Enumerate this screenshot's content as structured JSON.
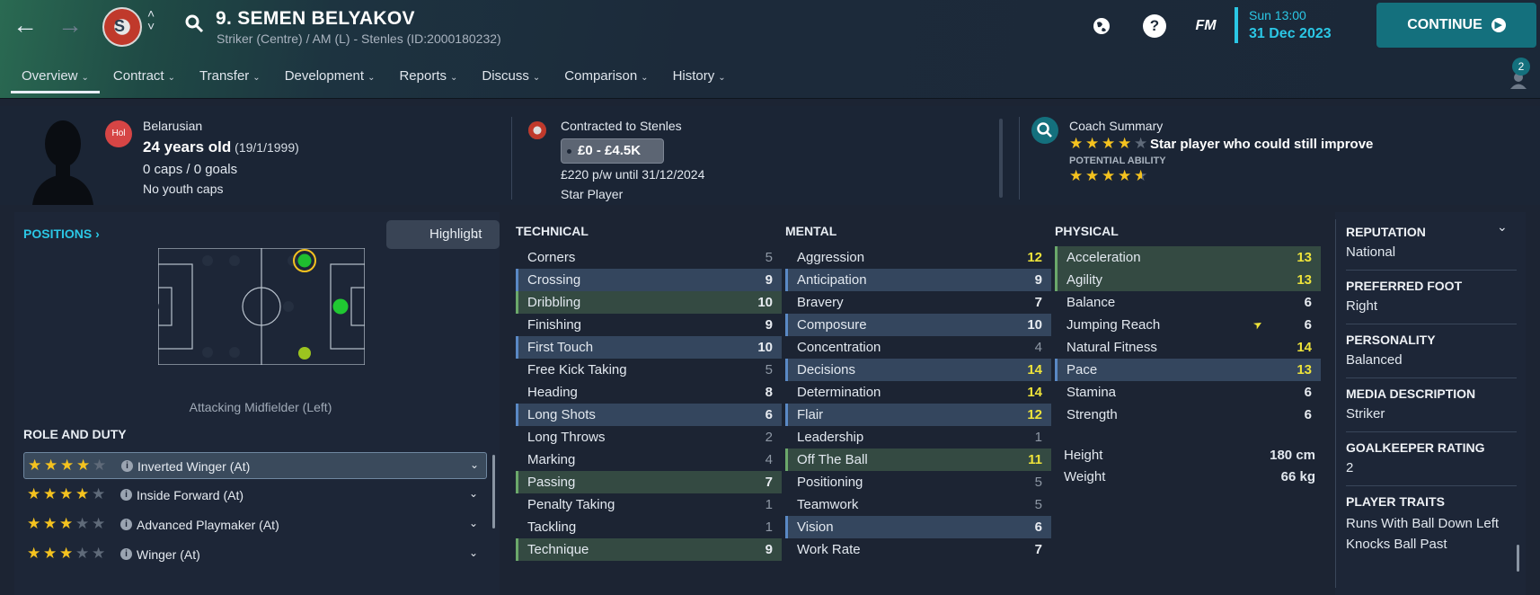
{
  "header": {
    "player_title": "9. SEMEN BELYAKOV",
    "subtitle": "Striker (Centre) / AM (L) - Stenles (ID:2000180232)",
    "fm_label": "FM",
    "time": "Sun 13:00",
    "date": "31 Dec 2023",
    "continue_label": "CONTINUE",
    "notification_count": "2",
    "icons": [
      "back-arrow-icon",
      "forward-arrow-icon",
      "club-badge-icon",
      "search-icon",
      "globe-icon",
      "help-icon",
      "notification-icon"
    ]
  },
  "tabs": [
    {
      "label": "Overview",
      "active": true
    },
    {
      "label": "Contract"
    },
    {
      "label": "Transfer"
    },
    {
      "label": "Development"
    },
    {
      "label": "Reports"
    },
    {
      "label": "Discuss"
    },
    {
      "label": "Comparison"
    },
    {
      "label": "History"
    }
  ],
  "profile": {
    "flag_label": "Hol",
    "nationality": "Belarusian",
    "age": "24 years old",
    "dob": "(19/1/1999)",
    "caps": "0 caps / 0 goals",
    "youth_caps": "No youth caps",
    "contracted": "Contracted to Stenles",
    "value": "£0 - £4.5K",
    "wage": "£220 p/w until 31/12/2024",
    "status": "Star Player",
    "coach_label": "Coach Summary",
    "coach_summary": "Star player who could still improve",
    "current_ability_stars": 4,
    "potential_label": "POTENTIAL ABILITY",
    "potential_ability_stars": 4.5
  },
  "positions": {
    "link_label": "POSITIONS",
    "highlight_label": "Highlight",
    "caption": "Attacking Midfielder (Left)",
    "role_header": "ROLE AND DUTY",
    "roles": [
      {
        "label": "Inverted Winger (At)",
        "stars": 4,
        "selected": true
      },
      {
        "label": "Inside Forward (At)",
        "stars": 4
      },
      {
        "label": "Advanced Playmaker (At)",
        "stars": 3
      },
      {
        "label": "Winger (At)",
        "stars": 3
      }
    ]
  },
  "technical": {
    "header": "TECHNICAL",
    "rows": [
      {
        "name": "Corners",
        "value": "5",
        "style": "plain",
        "tone": "low"
      },
      {
        "name": "Crossing",
        "value": "9",
        "style": "blue"
      },
      {
        "name": "Dribbling",
        "value": "10",
        "style": "green"
      },
      {
        "name": "Finishing",
        "value": "9",
        "style": "plain"
      },
      {
        "name": "First Touch",
        "value": "10",
        "style": "blue"
      },
      {
        "name": "Free Kick Taking",
        "value": "5",
        "style": "plain",
        "tone": "low"
      },
      {
        "name": "Heading",
        "value": "8",
        "style": "plain"
      },
      {
        "name": "Long Shots",
        "value": "6",
        "style": "blue"
      },
      {
        "name": "Long Throws",
        "value": "2",
        "style": "plain",
        "tone": "low"
      },
      {
        "name": "Marking",
        "value": "4",
        "style": "plain",
        "tone": "low"
      },
      {
        "name": "Passing",
        "value": "7",
        "style": "green"
      },
      {
        "name": "Penalty Taking",
        "value": "1",
        "style": "plain",
        "tone": "low"
      },
      {
        "name": "Tackling",
        "value": "1",
        "style": "plain",
        "tone": "low"
      },
      {
        "name": "Technique",
        "value": "9",
        "style": "green"
      }
    ]
  },
  "mental": {
    "header": "MENTAL",
    "rows": [
      {
        "name": "Aggression",
        "value": "12",
        "style": "plain",
        "tone": "yel"
      },
      {
        "name": "Anticipation",
        "value": "9",
        "style": "blue"
      },
      {
        "name": "Bravery",
        "value": "7",
        "style": "plain"
      },
      {
        "name": "Composure",
        "value": "10",
        "style": "blue"
      },
      {
        "name": "Concentration",
        "value": "4",
        "style": "plain",
        "tone": "low"
      },
      {
        "name": "Decisions",
        "value": "14",
        "style": "blue",
        "tone": "yel"
      },
      {
        "name": "Determination",
        "value": "14",
        "style": "plain",
        "tone": "yel"
      },
      {
        "name": "Flair",
        "value": "12",
        "style": "blue",
        "tone": "yel"
      },
      {
        "name": "Leadership",
        "value": "1",
        "style": "plain",
        "tone": "low"
      },
      {
        "name": "Off The Ball",
        "value": "11",
        "style": "green",
        "tone": "yel"
      },
      {
        "name": "Positioning",
        "value": "5",
        "style": "plain",
        "tone": "low"
      },
      {
        "name": "Teamwork",
        "value": "5",
        "style": "plain",
        "tone": "low"
      },
      {
        "name": "Vision",
        "value": "6",
        "style": "blue"
      },
      {
        "name": "Work Rate",
        "value": "7",
        "style": "plain"
      }
    ]
  },
  "physical": {
    "header": "PHYSICAL",
    "rows": [
      {
        "name": "Acceleration",
        "value": "13",
        "style": "green",
        "tone": "yel"
      },
      {
        "name": "Agility",
        "value": "13",
        "style": "green",
        "tone": "yel"
      },
      {
        "name": "Balance",
        "value": "6",
        "style": "plain"
      },
      {
        "name": "Jumping Reach",
        "value": "6",
        "style": "plain",
        "arrow": true
      },
      {
        "name": "Natural Fitness",
        "value": "14",
        "style": "plain",
        "tone": "yel"
      },
      {
        "name": "Pace",
        "value": "13",
        "style": "blue",
        "tone": "yel"
      },
      {
        "name": "Stamina",
        "value": "6",
        "style": "plain"
      },
      {
        "name": "Strength",
        "value": "6",
        "style": "plain"
      }
    ],
    "height_label": "Height",
    "height": "180 cm",
    "weight_label": "Weight",
    "weight": "66 kg"
  },
  "summary": [
    {
      "label": "REPUTATION",
      "value": "National"
    },
    {
      "label": "PREFERRED FOOT",
      "value": "Right"
    },
    {
      "label": "PERSONALITY",
      "value": "Balanced"
    },
    {
      "label": "MEDIA DESCRIPTION",
      "value": "Striker"
    },
    {
      "label": "GOALKEEPER RATING",
      "value": "2"
    }
  ],
  "traits": {
    "label": "PLAYER TRAITS",
    "items": [
      "Runs With Ball Down Left",
      "Knocks Ball Past"
    ]
  }
}
